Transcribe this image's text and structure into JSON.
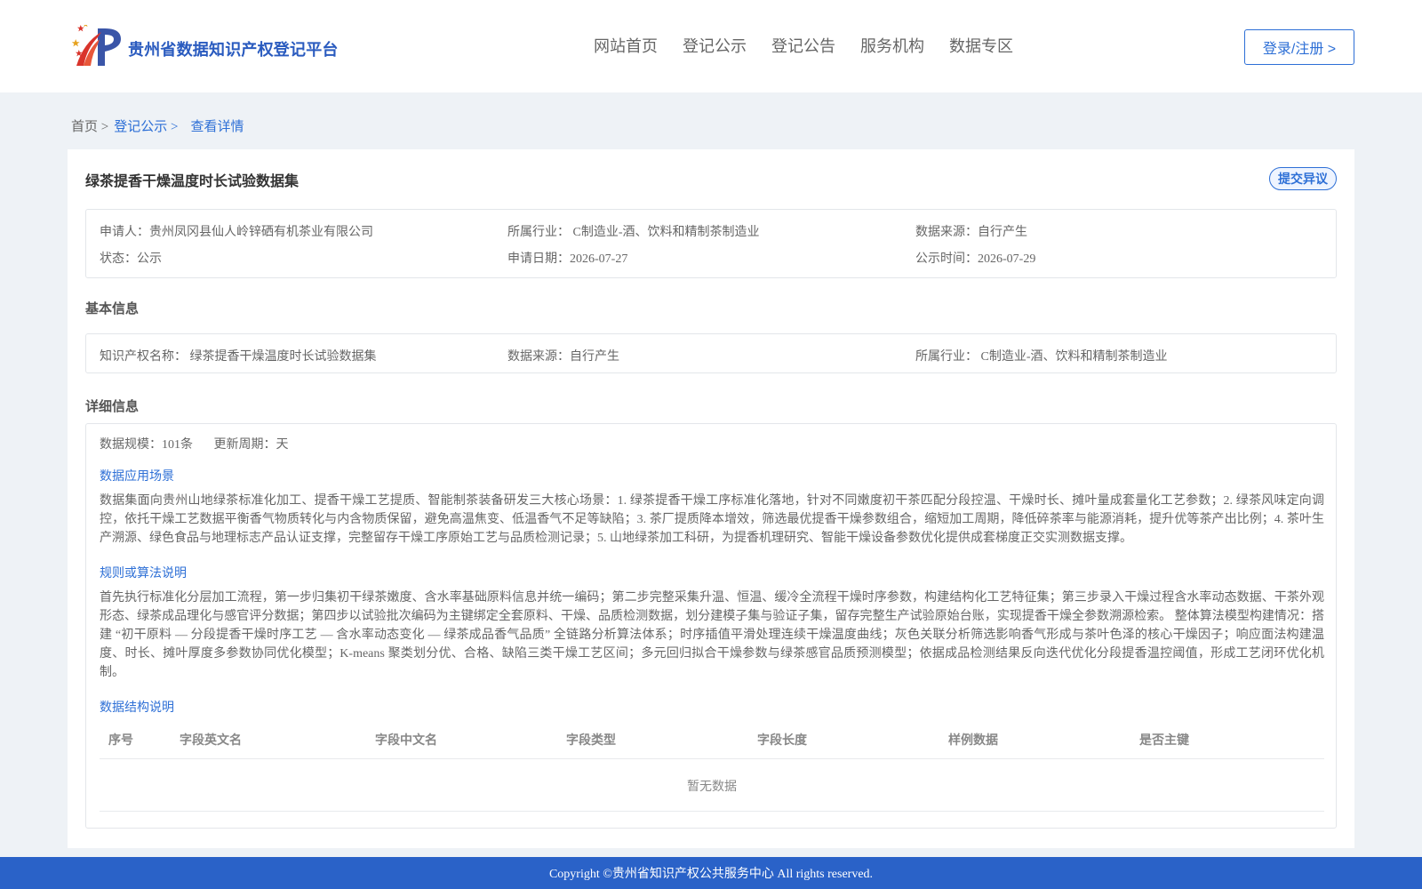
{
  "header": {
    "brand": "贵州省数据知识产权登记平台",
    "nav": [
      "网站首页",
      "登记公示",
      "登记公告",
      "服务机构",
      "数据专区"
    ],
    "login": "登录/注册 >"
  },
  "breadcrumb": {
    "home": "首页 >",
    "section": "登记公示 >",
    "current": "查看详情"
  },
  "card": {
    "title": "绿茶提香干燥温度时长试验数据集",
    "objection_button": "提交异议"
  },
  "summary": {
    "applicant": "申请人：贵州凤冈县仙人岭锌硒有机茶业有限公司",
    "industry": "所属行业： C制造业-酒、饮料和精制茶制造业",
    "source": "数据来源：自行产生",
    "status": "状态：公示",
    "apply_date": "申请日期：2026-07-27",
    "publish_date": "公示时间：2026-07-29"
  },
  "basic": {
    "section_title": "基本信息",
    "ip_name": "知识产权名称： 绿茶提香干燥温度时长试验数据集",
    "source": "数据来源：自行产生",
    "industry": "所属行业： C制造业-酒、饮料和精制茶制造业"
  },
  "detail": {
    "section_title": "详细信息",
    "scale": "数据规模：101条",
    "cycle": "更新周期：天",
    "scenario_title": "数据应用场景",
    "scenario_text": "数据集面向贵州山地绿茶标准化加工、提香干燥工艺提质、智能制茶装备研发三大核心场景：1. 绿茶提香干燥工序标准化落地，针对不同嫩度初干茶匹配分段控温、干燥时长、摊叶量成套量化工艺参数；2. 绿茶风味定向调控，依托干燥工艺数据平衡香气物质转化与内含物质保留，避免高温焦变、低温香气不足等缺陷；3. 茶厂提质降本增效，筛选最优提香干燥参数组合，缩短加工周期，降低碎茶率与能源消耗，提升优等茶产出比例；4. 茶叶生产溯源、绿色食品与地理标志产品认证支撑，完整留存干燥工序原始工艺与品质检测记录；5. 山地绿茶加工科研，为提香机理研究、智能干燥设备参数优化提供成套梯度正交实测数据支撑。",
    "algorithm_title": "规则或算法说明",
    "algorithm_text": "首先执行标准化分层加工流程，第一步归集初干绿茶嫩度、含水率基础原料信息并统一编码；第二步完整采集升温、恒温、缓冷全流程干燥时序参数，构建结构化工艺特征集；第三步录入干燥过程含水率动态数据、干茶外观形态、绿茶成品理化与感官评分数据；第四步以试验批次编码为主键绑定全套原料、干燥、品质检测数据，划分建模子集与验证子集，留存完整生产试验原始台账，实现提香干燥全参数溯源检索。 整体算法模型构建情况：搭建 “初干原料 — 分段提香干燥时序工艺 — 含水率动态变化 — 绿茶成品香气品质” 全链路分析算法体系；时序插值平滑处理连续干燥温度曲线；灰色关联分析筛选影响香气形成与茶叶色泽的核心干燥因子；响应面法构建温度、时长、摊叶厚度多参数协同优化模型；K-means 聚类划分优、合格、缺陷三类干燥工艺区间；多元回归拟合干燥参数与绿茶感官品质预测模型；依据成品检测结果反向迭代优化分段提香温控阈值，形成工艺闭环优化机制。",
    "structure_title": "数据结构说明",
    "table_headers": [
      "序号",
      "字段英文名",
      "字段中文名",
      "字段类型",
      "字段长度",
      "样例数据",
      "是否主键"
    ],
    "empty_text": "暂无数据"
  },
  "footer": {
    "copyright": "Copyright ©贵州省知识产权公共服务中心 All rights reserved."
  },
  "colors": {
    "primary": "#2d6fd6",
    "footer_bg": "#2a62c8",
    "page_bg": "#eef2f6"
  }
}
